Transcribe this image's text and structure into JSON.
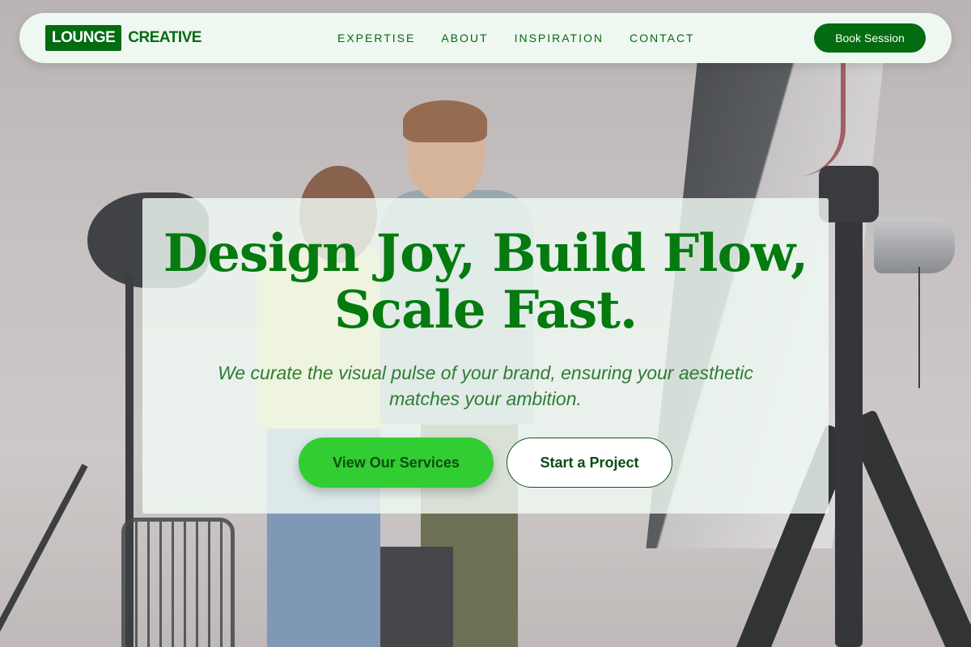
{
  "brand": {
    "box_text": "LOUNGE",
    "text": "CREATIVE"
  },
  "nav": {
    "links": [
      {
        "label": "EXPERTISE"
      },
      {
        "label": "ABOUT"
      },
      {
        "label": "INSPIRATION"
      },
      {
        "label": "CONTACT"
      }
    ],
    "cta_label": "Book Session"
  },
  "hero": {
    "title_line1": "Design Joy, Build Flow,",
    "title_line2": "Scale Fast.",
    "subtitle_line1": "We curate the visual pulse of your brand, ensuring your aesthetic",
    "subtitle_line2": "matches your ambition.",
    "primary_button": "View Our Services",
    "secondary_button": "Start a Project"
  },
  "colors": {
    "brand_green": "#036b10",
    "accent_green": "#32cd32",
    "title_green": "#047a0f"
  }
}
